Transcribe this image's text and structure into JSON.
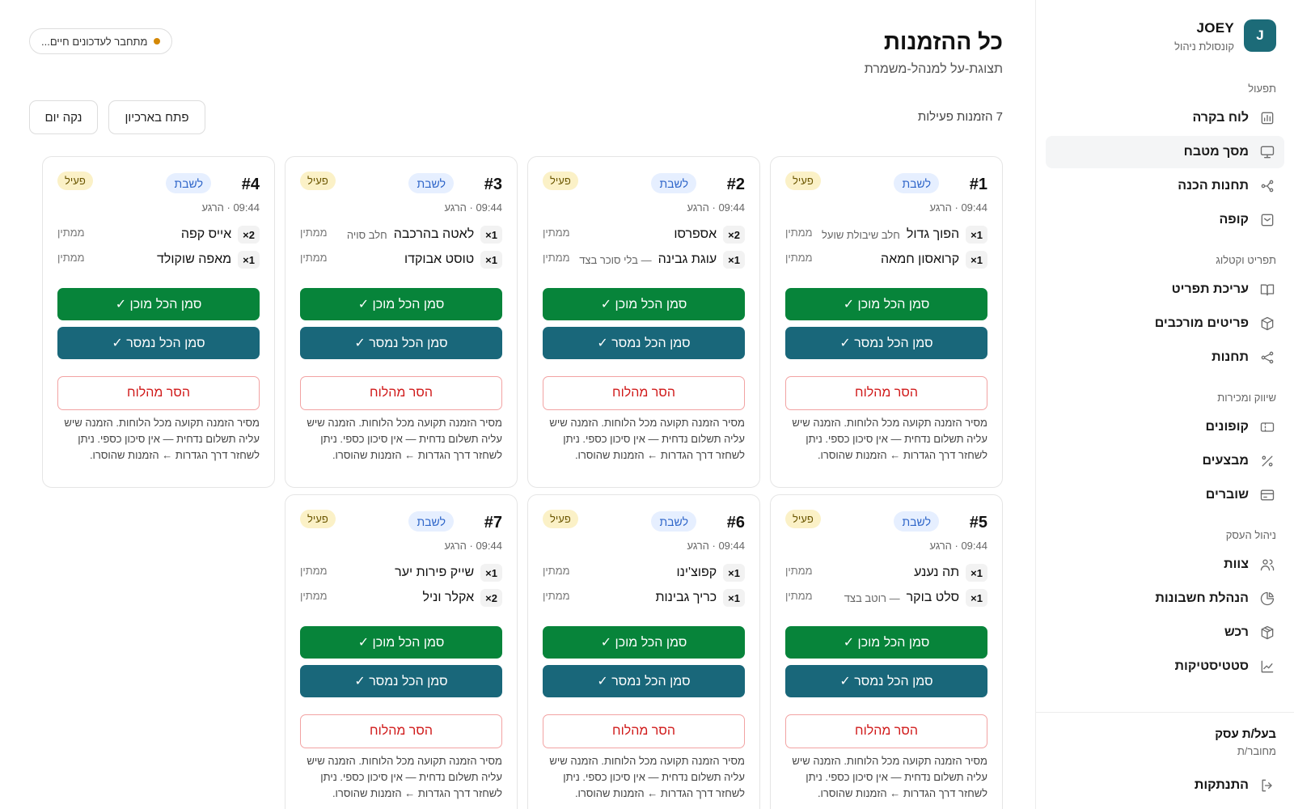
{
  "brand": {
    "logo": "J",
    "name": "JOEY",
    "subtitle": "קונסולת ניהול"
  },
  "sidebar": {
    "sections": [
      {
        "title": "תפעול",
        "items": [
          {
            "label": "לוח בקרה",
            "icon": "chart-icon",
            "active": false
          },
          {
            "label": "מסך מטבח",
            "icon": "monitor-icon",
            "active": true
          },
          {
            "label": "תחנות הכנה",
            "icon": "stations-icon",
            "active": false
          },
          {
            "label": "קופה",
            "icon": "register-icon",
            "active": false
          }
        ]
      },
      {
        "title": "תפריט וקטלוג",
        "items": [
          {
            "label": "עריכת תפריט",
            "icon": "book-icon",
            "active": false
          },
          {
            "label": "פריטים מורכבים",
            "icon": "box-icon",
            "active": false
          },
          {
            "label": "תחנות",
            "icon": "share-icon",
            "active": false
          }
        ]
      },
      {
        "title": "שיווק ומכירות",
        "items": [
          {
            "label": "קופונים",
            "icon": "ticket-icon",
            "active": false
          },
          {
            "label": "מבצעים",
            "icon": "percent-icon",
            "active": false
          },
          {
            "label": "שוברים",
            "icon": "card-icon",
            "active": false
          }
        ]
      },
      {
        "title": "ניהול העסק",
        "items": [
          {
            "label": "צוות",
            "icon": "users-icon",
            "active": false
          },
          {
            "label": "הנהלת חשבונות",
            "icon": "pie-icon",
            "active": false
          },
          {
            "label": "רכש",
            "icon": "package-icon",
            "active": false
          },
          {
            "label": "סטטיסטיקות",
            "icon": "trend-icon",
            "active": false
          }
        ]
      }
    ],
    "footer": {
      "owner": "בעל/ת עסק",
      "status": "מחובר/ת",
      "logout": "התנתקות"
    }
  },
  "header": {
    "title": "כל ההזמנות",
    "subtitle": "תצוגת-על למנהל-משמרת",
    "live_status": "מתחבר לעדכונים חיים...",
    "active_count": "7 הזמנות פעילות",
    "archive_button": "פתח בארכיון",
    "clean_button": "נקה יום"
  },
  "card_labels": {
    "sabbath_tag": "לשבת",
    "status": "פעיל",
    "item_status": "ממתין",
    "ready_button": "סמן הכל מוכן ✓",
    "delivered_button": "סמן הכל נמסר ✓",
    "remove_button": "הסר מהלוח",
    "remove_warning": "מסיר הזמנה תקועה מכל הלוחות. הזמנה שיש עליה תשלום נדחית — אין סיכון כספי. ניתן לשחזר דרך הגדרות ← הזמנות שהוסרו."
  },
  "orders": [
    {
      "number": "#1",
      "time": "09:44 · הרגע",
      "items": [
        {
          "qty": "1×",
          "name": "הפוך גדול",
          "mod": "חלב שיבולת שועל"
        },
        {
          "qty": "1×",
          "name": "קרואסון חמאה",
          "mod": ""
        }
      ]
    },
    {
      "number": "#2",
      "time": "09:44 · הרגע",
      "items": [
        {
          "qty": "2×",
          "name": "אספרסו",
          "mod": ""
        },
        {
          "qty": "1×",
          "name": "עוגת גבינה",
          "mod": "— בלי סוכר בצד"
        }
      ]
    },
    {
      "number": "#3",
      "time": "09:44 · הרגע",
      "items": [
        {
          "qty": "1×",
          "name": "לאטה בהרכבה",
          "mod": "חלב סויה"
        },
        {
          "qty": "1×",
          "name": "טוסט אבוקדו",
          "mod": ""
        }
      ]
    },
    {
      "number": "#4",
      "time": "09:44 · הרגע",
      "items": [
        {
          "qty": "2×",
          "name": "אייס קפה",
          "mod": ""
        },
        {
          "qty": "1×",
          "name": "מאפה שוקולד",
          "mod": ""
        }
      ]
    },
    {
      "number": "#5",
      "time": "09:44 · הרגע",
      "items": [
        {
          "qty": "1×",
          "name": "תה נענע",
          "mod": ""
        },
        {
          "qty": "1×",
          "name": "סלט בוקר",
          "mod": "— רוטב בצד"
        }
      ]
    },
    {
      "number": "#6",
      "time": "09:44 · הרגע",
      "items": [
        {
          "qty": "1×",
          "name": "קפוצ'ינו",
          "mod": ""
        },
        {
          "qty": "1×",
          "name": "כריך גבינות",
          "mod": ""
        }
      ]
    },
    {
      "number": "#7",
      "time": "09:44 · הרגע",
      "items": [
        {
          "qty": "1×",
          "name": "שייק פירות יער",
          "mod": ""
        },
        {
          "qty": "2×",
          "name": "אקלר וניל",
          "mod": ""
        }
      ]
    }
  ],
  "colors": {
    "accent": "#1c6b78",
    "ready": "#07843a",
    "delivered": "#19677a",
    "remove": "#d01919",
    "live_dot": "#d48806"
  }
}
